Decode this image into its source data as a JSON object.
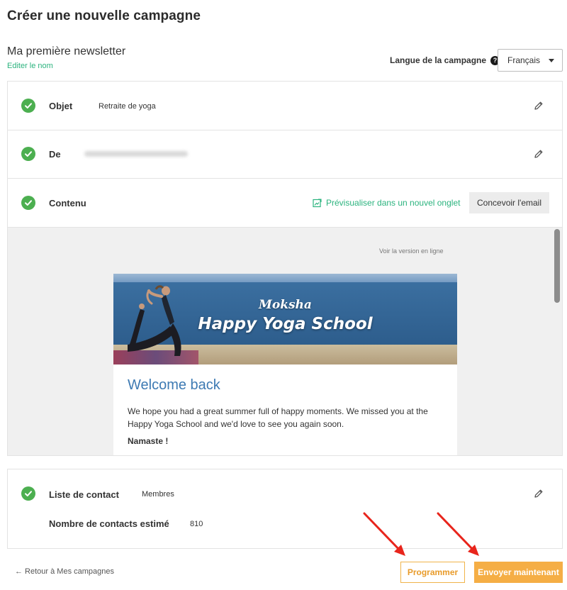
{
  "page": {
    "title": "Créer une nouvelle campagne"
  },
  "campaign": {
    "name": "Ma première newsletter",
    "edit_label": "Editer le nom"
  },
  "language": {
    "label": "Langue de la campagne",
    "help_symbol": "?",
    "selected": "Français"
  },
  "steps": {
    "subject": {
      "label": "Objet",
      "value": "Retraite de yoga"
    },
    "sender": {
      "label": "De"
    },
    "content": {
      "label": "Contenu",
      "preview_link": "Prévisualiser dans un nouvel onglet",
      "design_button": "Concevoir l'email"
    }
  },
  "email_preview": {
    "view_online": "Voir la version en ligne",
    "brand_sub": "Moksha",
    "brand_main": "Happy Yoga School",
    "heading": "Welcome back",
    "message": "We hope you had a great summer full of happy moments. We missed you at the Happy Yoga School and we'd love to see you again soon.",
    "sign_off": "Namaste !"
  },
  "contacts": {
    "label": "Liste de contact",
    "value": "Membres",
    "estimate_label": "Nombre de contacts estimé",
    "estimate_value": "810"
  },
  "footer": {
    "back_label": "← Retour à Mes campagnes",
    "schedule_label": "Programmer",
    "send_label": "Envoyer maintenant"
  },
  "colors": {
    "accent_green": "#2bb37e",
    "check_green": "#4caf50",
    "primary_orange": "#f5ae45",
    "heading_blue": "#3d7ab3",
    "annotation_red": "#e8251c"
  }
}
